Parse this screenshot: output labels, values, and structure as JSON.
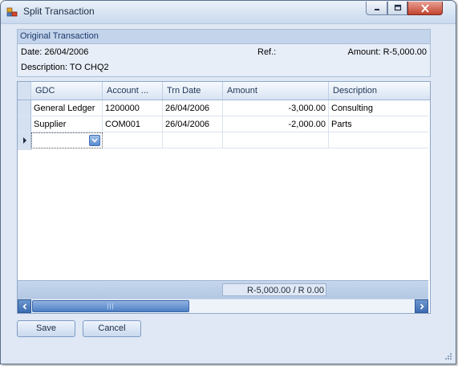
{
  "window": {
    "title": "Split Transaction",
    "icon": "split-transaction-icon"
  },
  "original": {
    "header": "Original Transaction",
    "date": "Date: 26/04/2006",
    "ref": "Ref.:",
    "amount": "Amount: R-5,000.00",
    "description": "Description: TO CHQ2"
  },
  "grid": {
    "columns": [
      "GDC",
      "Account ...",
      "Trn Date",
      "Amount",
      "Description"
    ],
    "rows": [
      {
        "gdc": "General Ledger",
        "account": "1200000",
        "date": "26/04/2006",
        "amount": "-3,000.00",
        "description": "Consulting"
      },
      {
        "gdc": "Supplier",
        "account": "COM001",
        "date": "26/04/2006",
        "amount": "-2,000.00",
        "description": "Parts"
      }
    ],
    "total": "R-5,000.00 / R 0.00",
    "scroll_grip": "|||"
  },
  "buttons": {
    "save": "Save",
    "cancel": "Cancel"
  },
  "colors": {
    "accent": "#c3d4eb",
    "close": "#c2432d"
  }
}
